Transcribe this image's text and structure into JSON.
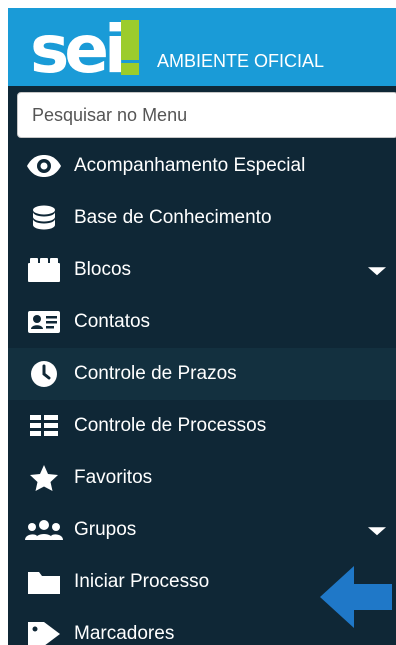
{
  "header": {
    "logo_text": "sei!",
    "environment": "AMBIENTE OFICIAL"
  },
  "search": {
    "placeholder": "Pesquisar no Menu",
    "value": ""
  },
  "menu": {
    "items": [
      {
        "label": "Acompanhamento Especial",
        "icon": "eye-icon",
        "has_submenu": false
      },
      {
        "label": "Base de Conhecimento",
        "icon": "database-icon",
        "has_submenu": false
      },
      {
        "label": "Blocos",
        "icon": "blocks-icon",
        "has_submenu": true
      },
      {
        "label": "Contatos",
        "icon": "contact-card-icon",
        "has_submenu": false
      },
      {
        "label": "Controle de Prazos",
        "icon": "clock-icon",
        "has_submenu": false,
        "highlighted": true
      },
      {
        "label": "Controle de Processos",
        "icon": "list-grid-icon",
        "has_submenu": false
      },
      {
        "label": "Favoritos",
        "icon": "star-icon",
        "has_submenu": false
      },
      {
        "label": "Grupos",
        "icon": "users-icon",
        "has_submenu": true
      },
      {
        "label": "Iniciar Processo",
        "icon": "folder-icon",
        "has_submenu": false
      },
      {
        "label": "Marcadores",
        "icon": "tag-icon",
        "has_submenu": false
      }
    ]
  },
  "annotation": {
    "arrow_color": "#1f78c8",
    "points_to": "Iniciar Processo"
  },
  "colors": {
    "header_bg": "#1a9bd7",
    "sidebar_bg": "#0f2736",
    "highlight_bg": "#13303f",
    "logo_accent": "#9ccc2c"
  }
}
